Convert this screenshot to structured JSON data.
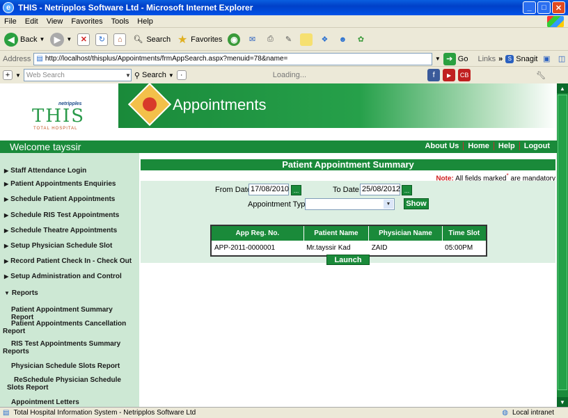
{
  "window": {
    "title": "THIS - Netripplos Software Ltd - Microsoft Internet Explorer",
    "icon_name": "ie-icon"
  },
  "menubar": {
    "items": [
      "File",
      "Edit",
      "View",
      "Favorites",
      "Tools",
      "Help"
    ]
  },
  "toolbar": {
    "back": "Back",
    "search": "Search",
    "favorites": "Favorites"
  },
  "address": {
    "label": "Address",
    "url": "http://localhost/thisplus/Appointments/frmAppSearch.aspx?menuid=78&name=",
    "go": "Go",
    "links": "Links",
    "snagit": "Snagit"
  },
  "searchbar": {
    "placeholder": "Web Search",
    "search": "Search",
    "loading": "Loading..."
  },
  "header": {
    "logo_text": "THIS",
    "logo_tiny": "netripples",
    "logo_sub": "TOTAL HOSPITAL",
    "banner_title": "Appointments"
  },
  "welcome": {
    "text": "Welcome  tayssir",
    "links": [
      "About Us",
      "Home",
      "Help",
      "Logout"
    ]
  },
  "sidebar": {
    "items": [
      {
        "label": "Staff Attendance Login",
        "marker": "▶"
      },
      {
        "label": "Patient Appointments Enquiries",
        "marker": "▶"
      },
      {
        "label": "Schedule Patient Appointments",
        "marker": "▶"
      },
      {
        "label": "Schedule RIS Test Appointments",
        "marker": "▶"
      },
      {
        "label": "Schedule Theatre Appointments",
        "marker": "▶"
      },
      {
        "label": "Setup Physician Schedule Slot",
        "marker": "▶"
      },
      {
        "label": "Record Patient Check In - Check Out",
        "marker": "▶"
      },
      {
        "label": "Setup Administration and Control",
        "marker": "▶"
      },
      {
        "label": "Reports",
        "marker": "▼"
      }
    ],
    "subitems": [
      "Patient Appointment Summary Report",
      "Patient Appointments Cancellation Report",
      "RIS Test Appointments Summary Reports",
      "Physician Schedule Slots Report",
      "ReSchedule Physician Schedule Slots Report",
      "Appointment Letters"
    ]
  },
  "main": {
    "title": "Patient Appointment Summary",
    "note_label": "Note:",
    "note_text": " All fields marked",
    "note_star": "*",
    "note_tail": " are mandatory",
    "from_date_label": "From Date",
    "from_date_value": "17/08/2010",
    "to_date_label": "To Date",
    "to_date_value": "25/08/2012",
    "dots": "...",
    "appt_type_label": "Appointment Type",
    "appt_type_value": "",
    "show_button": "Show",
    "launch_button": "Launch",
    "table": {
      "headers": [
        "App Reg. No.",
        "Patient Name",
        "Physician Name",
        "Time Slot"
      ],
      "rows": [
        [
          "APP-2011-0000001",
          "Mr.tayssir Kad",
          "ZAID",
          "05:00PM"
        ]
      ]
    }
  },
  "status": {
    "text": "Total Hospital Information System - Netripplos Software Ltd",
    "zone": "Local intranet"
  },
  "colors": {
    "brand_green": "#1a8a3a",
    "sidebar_bg": "#cde8d4",
    "note_red": "#d02020"
  }
}
